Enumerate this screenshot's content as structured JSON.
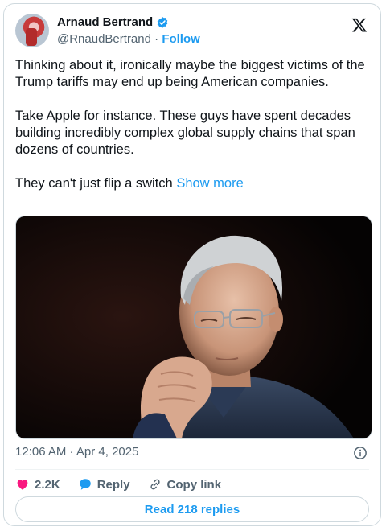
{
  "author": {
    "display_name": "Arnaud Bertrand",
    "handle": "@RnaudBertrand",
    "separator": " · ",
    "follow_label": "Follow",
    "verified_color": "#1d9bf0"
  },
  "tweet": {
    "paragraphs": [
      "Thinking about it, ironically maybe the biggest victims of the Trump tariffs may end up being American companies.",
      "Take Apple for instance. These guys have spent decades building incredibly complex global supply chains that span dozens of countries."
    ],
    "last_line": "They can't just flip a switch ",
    "show_more_label": "Show more"
  },
  "meta": {
    "timestamp": "12:06 AM · Apr 4, 2025"
  },
  "actions": {
    "like_count": "2.2K",
    "reply_label": "Reply",
    "copy_link_label": "Copy link",
    "read_replies_label": "Read 218 replies"
  },
  "colors": {
    "accent": "#1d9bf0",
    "like": "#f91880",
    "muted": "#536471",
    "border": "#cfd9de"
  },
  "icons": [
    "verified-badge-icon",
    "x-logo-icon",
    "info-icon",
    "heart-icon",
    "reply-bubble-icon",
    "link-icon"
  ]
}
